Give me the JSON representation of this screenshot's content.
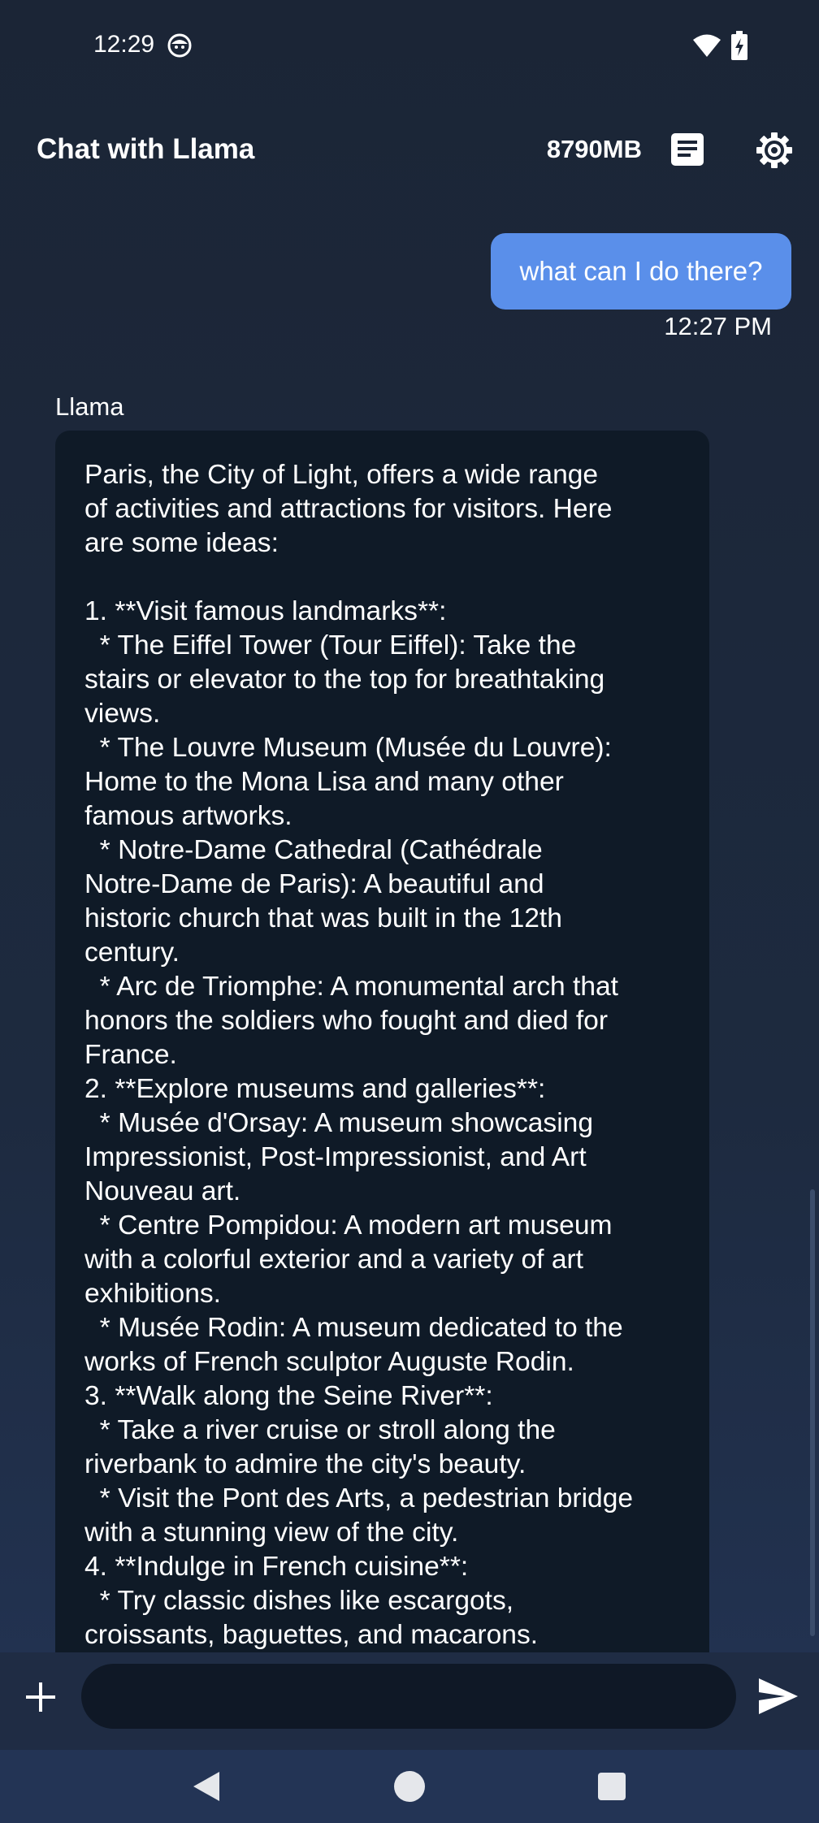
{
  "status_bar": {
    "time": "12:29",
    "icons": [
      "face-icon",
      "wifi-icon",
      "battery-charging-icon"
    ]
  },
  "app_bar": {
    "title": "Chat with Llama",
    "memory": "8790MB",
    "actions": [
      "document-icon",
      "gear-icon"
    ]
  },
  "conversation": {
    "user_message": {
      "text": "what can I do there?",
      "time": "12:27 PM",
      "bubble_color": "#5a8fea"
    },
    "assistant_message": {
      "sender": "Llama",
      "bubble_color": "#0f1a27",
      "text": "Paris, the City of Light, offers a wide range\nof activities and attractions for visitors. Here\nare some ideas:\n\n1. **Visit famous landmarks**:\n  * The Eiffel Tower (Tour Eiffel): Take the\nstairs or elevator to the top for breathtaking\nviews.\n  * The Louvre Museum (Musée du Louvre):\nHome to the Mona Lisa and many other\nfamous artworks.\n  * Notre-Dame Cathedral (Cathédrale\nNotre-Dame de Paris): A beautiful and\nhistoric church that was built in the 12th\ncentury.\n  * Arc de Triomphe: A monumental arch that\nhonors the soldiers who fought and died for\nFrance.\n2. **Explore museums and galleries**:\n  * Musée d'Orsay: A museum showcasing\nImpressionist, Post-Impressionist, and Art\nNouveau art.\n  * Centre Pompidou: A modern art museum\nwith a colorful exterior and a variety of art\nexhibitions.\n  * Musée Rodin: A museum dedicated to the\nworks of French sculptor Auguste Rodin.\n3. **Walk along the Seine River**:\n  * Take a river cruise or stroll along the\nriverbank to admire the city's beauty.\n  * Visit the Pont des Arts, a pedestrian bridge\nwith a stunning view of the city.\n4. **Indulge in French cuisine**:\n  * Try classic dishes like escargots,\ncroissants, baguettes, and macarons."
    }
  },
  "composer": {
    "input_value": "",
    "icons": [
      "plus-icon",
      "send-icon"
    ]
  },
  "nav_bar": {
    "icons": [
      "back-icon",
      "home-icon",
      "recents-icon"
    ]
  }
}
